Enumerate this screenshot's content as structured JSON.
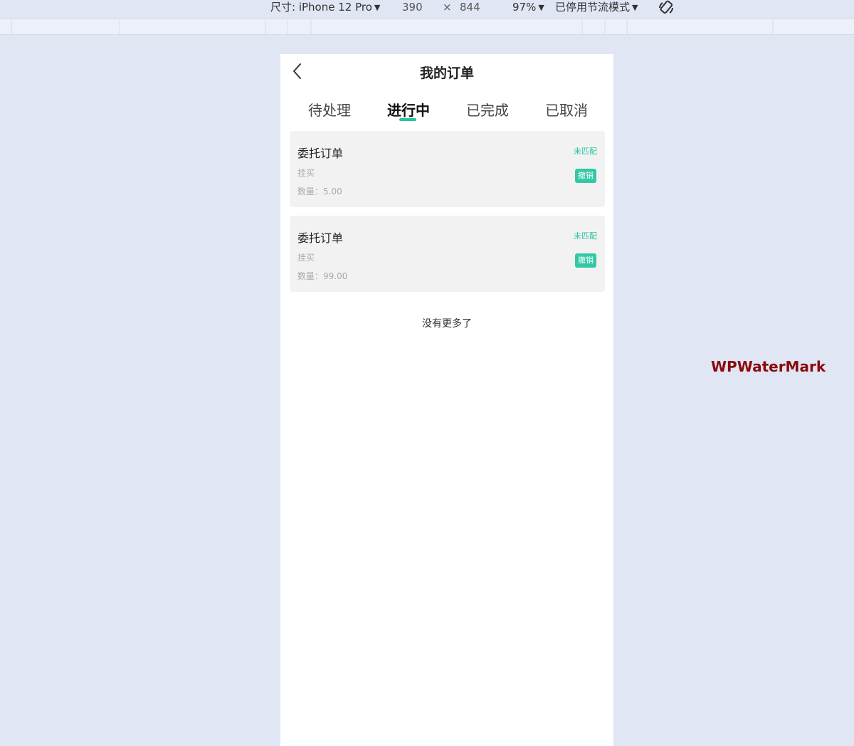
{
  "devtools": {
    "device_label": "尺寸: iPhone 12 Pro",
    "width": "390",
    "times": "×",
    "height": "844",
    "zoom": "97%",
    "throttle": "已停用节流模式",
    "rotate_icon": "rotate-icon"
  },
  "header": {
    "back_icon": "chevron-left-icon",
    "title": "我的订单"
  },
  "tabs": [
    {
      "label": "待处理",
      "active": false
    },
    {
      "label": "进行中",
      "active": true
    },
    {
      "label": "已完成",
      "active": false
    },
    {
      "label": "已取消",
      "active": false
    }
  ],
  "orders": [
    {
      "title": "委托订单",
      "type": "挂买",
      "quantity": "数量：5.00",
      "status": "未匹配",
      "action": "撤销"
    },
    {
      "title": "委托订单",
      "type": "挂买",
      "quantity": "数量：99.00",
      "status": "未匹配",
      "action": "撤销"
    }
  ],
  "footer": {
    "no_more": "没有更多了"
  },
  "watermark": "WPWaterMark",
  "colors": {
    "accent": "#28c39f",
    "button": "#33c8a4",
    "card_bg": "#f2f2f2",
    "page_bg": "#e1e6f4",
    "watermark": "#8b0a0a"
  }
}
